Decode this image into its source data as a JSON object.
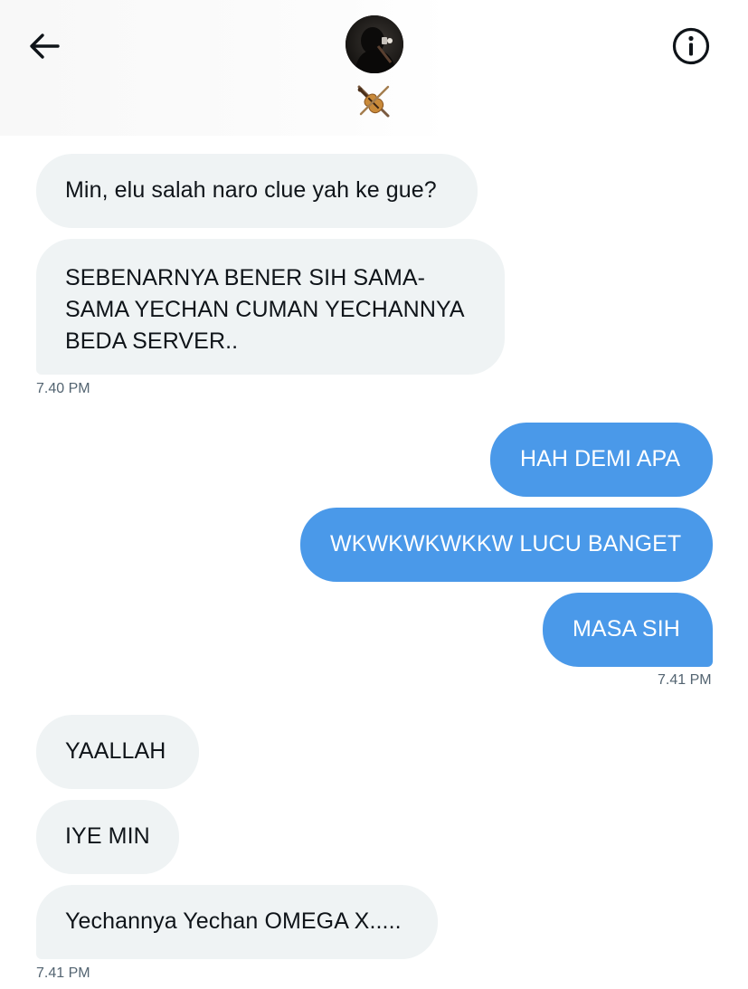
{
  "header": {
    "back_icon": "arrow-left-icon",
    "info_icon": "info-circle-icon",
    "avatar_alt": "profile photo",
    "profile_emoji": "violin-crossed-icon"
  },
  "messages": [
    {
      "side": "in",
      "text": "Min, elu salah naro clue yah ke gue?"
    },
    {
      "side": "in",
      "lines": [
        "SEBENARNYA BENER SIH SAMA-",
        "SAMA YECHAN CUMAN YECHANNYA",
        "BEDA SERVER.."
      ]
    },
    {
      "side": "out",
      "text": "HAH DEMI APA"
    },
    {
      "side": "out",
      "text": "WKWKWKWKKW LUCU BANGET"
    },
    {
      "side": "out",
      "text": "MASA SIH"
    },
    {
      "side": "in",
      "text": "YAALLAH"
    },
    {
      "side": "in",
      "text": "IYE MIN"
    },
    {
      "side": "in",
      "text": "Yechannya Yechan OMEGA X....."
    }
  ],
  "timestamps": {
    "group1": "7.40 PM",
    "group2": "7.41 PM",
    "group3": "7.41 PM"
  },
  "colors": {
    "incoming_bubble": "#eff3f4",
    "outgoing_bubble": "#4a99e9",
    "timestamp": "#536471"
  }
}
